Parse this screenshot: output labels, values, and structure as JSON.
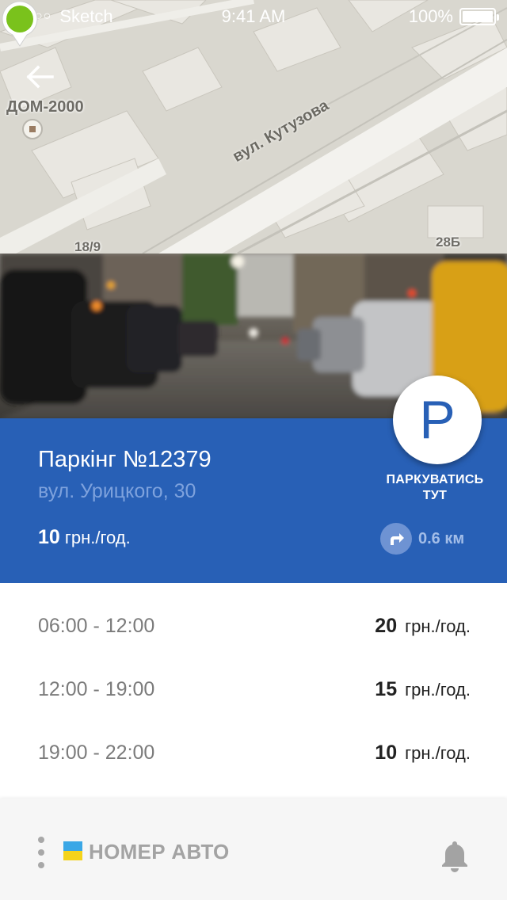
{
  "status_bar": {
    "signal_dots": "●●●○○",
    "carrier": "Sketch",
    "time": "9:41 AM",
    "battery": "100%"
  },
  "map": {
    "place_label": "ДОМ-2000",
    "street_label": "вул. Кутузова",
    "house_number_1": "18/9",
    "house_number_2": "28Б",
    "pin_color": "#7ac21c"
  },
  "parking": {
    "title": "Паркінг №12379",
    "address": "вул. Урицкого, 30",
    "price_value": "10",
    "price_unit": "грн./год.",
    "fab_letter": "P",
    "park_here_line1": "ПАРКУВАТИСЬ",
    "park_here_line2": "ТУТ",
    "distance": "0.6 км"
  },
  "schedule": [
    {
      "time": "06:00 - 12:00",
      "price": "20",
      "unit": "грн./год."
    },
    {
      "time": "12:00 - 19:00",
      "price": "15",
      "unit": "грн./год."
    },
    {
      "time": "19:00 - 22:00",
      "price": "10",
      "unit": "грн./год."
    }
  ],
  "bottom_bar": {
    "plate_label": "НОМЕР АВТО"
  },
  "colors": {
    "primary_blue": "#2860b6",
    "flag_blue": "#3aa7e6",
    "flag_yellow": "#f4d31a"
  }
}
